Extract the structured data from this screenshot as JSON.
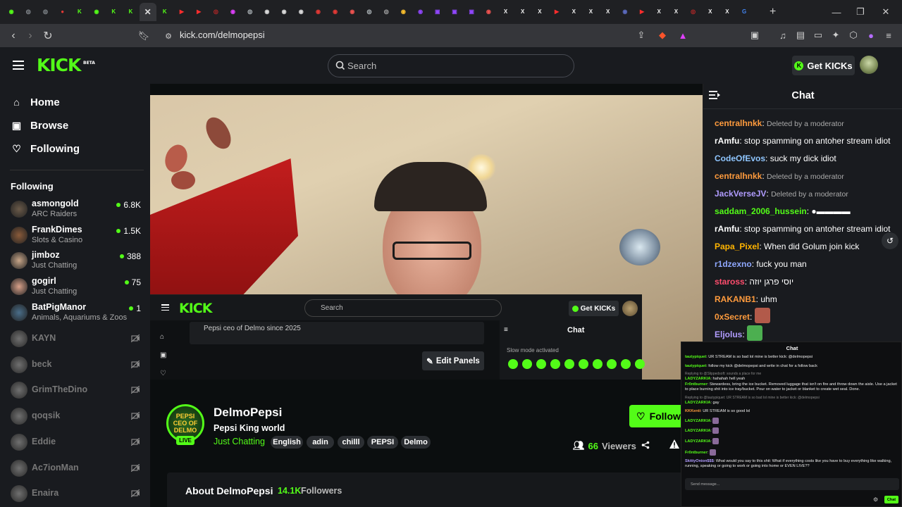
{
  "browser": {
    "tabs": [
      {
        "c": "#53fc18",
        "g": "◉"
      },
      {
        "c": "#9aa0a6",
        "g": "◎"
      },
      {
        "c": "#9aa0a6",
        "g": "◎"
      },
      {
        "c": "#e53935",
        "g": "●"
      },
      {
        "c": "#53fc18",
        "g": "K"
      },
      {
        "c": "#53fc18",
        "g": "◉"
      },
      {
        "c": "#53fc18",
        "g": "K"
      },
      {
        "c": "#53fc18",
        "g": "K"
      },
      {
        "c": "#ddd",
        "g": "✕",
        "active": true
      },
      {
        "c": "#53fc18",
        "g": "K"
      },
      {
        "c": "#ff2d2d",
        "g": "▶"
      },
      {
        "c": "#ff2d2d",
        "g": "▶"
      },
      {
        "c": "#c62828",
        "g": "◎"
      },
      {
        "c": "#e040fb",
        "g": "◉"
      },
      {
        "c": "#cfd8dc",
        "g": "◎"
      },
      {
        "c": "#ddd",
        "g": "◉"
      },
      {
        "c": "#ddd",
        "g": "◉"
      },
      {
        "c": "#ddd",
        "g": "◉"
      },
      {
        "c": "#e53935",
        "g": "◉"
      },
      {
        "c": "#e53935",
        "g": "◉"
      },
      {
        "c": "#ef5350",
        "g": "◉"
      },
      {
        "c": "#cfd8dc",
        "g": "◎"
      },
      {
        "c": "#bbb",
        "g": "◎"
      },
      {
        "c": "#fbc02d",
        "g": "◉"
      },
      {
        "c": "#9146ff",
        "g": "◉"
      },
      {
        "c": "#9146ff",
        "g": "▣"
      },
      {
        "c": "#9146ff",
        "g": "▣"
      },
      {
        "c": "#9146ff",
        "g": "▣"
      },
      {
        "c": "#ef5350",
        "g": "◉"
      },
      {
        "c": "#eee",
        "g": "X"
      },
      {
        "c": "#eee",
        "g": "X"
      },
      {
        "c": "#eee",
        "g": "X"
      },
      {
        "c": "#ff2d2d",
        "g": "▶"
      },
      {
        "c": "#eee",
        "g": "X"
      },
      {
        "c": "#eee",
        "g": "X"
      },
      {
        "c": "#eee",
        "g": "X"
      },
      {
        "c": "#5c6bc0",
        "g": "◉"
      },
      {
        "c": "#ff2d2d",
        "g": "▶"
      },
      {
        "c": "#eee",
        "g": "X"
      },
      {
        "c": "#eee",
        "g": "X"
      },
      {
        "c": "#c62828",
        "g": "◎"
      },
      {
        "c": "#eee",
        "g": "X"
      },
      {
        "c": "#eee",
        "g": "X"
      },
      {
        "c": "#4285f4",
        "g": "G"
      }
    ],
    "url": "kick.com/delmopepsi"
  },
  "header": {
    "logo": "KICK",
    "logo_sup": "BETA",
    "search_placeholder": "Search",
    "get_kicks": "Get KICKs"
  },
  "sidebar": {
    "nav": [
      {
        "label": "Home",
        "icon": "home-icon"
      },
      {
        "label": "Browse",
        "icon": "browse-icon"
      },
      {
        "label": "Following",
        "icon": "heart-icon"
      }
    ],
    "following_heading": "Following",
    "live": [
      {
        "name": "asmongold",
        "cat": "ARC Raiders",
        "viewers": "6.8K",
        "color": "#6b5b4a"
      },
      {
        "name": "FrankDimes",
        "cat": "Slots & Casino",
        "viewers": "1.5K",
        "color": "#8a5b3a"
      },
      {
        "name": "jimboz",
        "cat": "Just Chatting",
        "viewers": "388",
        "color": "#c9a78a"
      },
      {
        "name": "gogirl",
        "cat": "Just Chatting",
        "viewers": "75",
        "color": "#d9a18a"
      },
      {
        "name": "BatPigManor",
        "cat": "Animals, Aquariums & Zoos",
        "viewers": "1",
        "color": "#4a6e8a"
      }
    ],
    "offline": [
      "KAYN",
      "beck",
      "GrimTheDino",
      "qoqsik",
      "Eddie",
      "Ac7ionMan",
      "Enaira"
    ]
  },
  "video_overlay": {
    "search": "Search",
    "get_kicks": "Get KICKs",
    "bio": "Pepsi ceo of Delmo since 2025",
    "edit_panels": "Edit Panels",
    "chat_title": "Chat",
    "slow_mode": "Slow mode activated"
  },
  "channel": {
    "name": "DelmoPepsi",
    "title": "Pepsi King world",
    "category": "Just Chatting",
    "tags": [
      "English",
      "adin",
      "chilll",
      "PEPSI",
      "Delmo"
    ],
    "live": "LIVE",
    "follow": "Follow",
    "viewers_count": "66",
    "viewers_label": "Viewers",
    "avatar_text": "PEPSI CEO OF DELMO",
    "about_title": "About DelmoPepsi",
    "followers_count": "14.1K",
    "followers_label": "Followers"
  },
  "chat": {
    "title": "Chat",
    "messages": [
      {
        "user": "centralhnkk",
        "color": "#ff9b3d",
        "text": "Deleted by a moderator",
        "deleted": true
      },
      {
        "user": "rAmfu",
        "color": "#ffffff",
        "text": "stop spamming on antoher stream idiot"
      },
      {
        "user": "CodeOfEvos",
        "color": "#8fc6ff",
        "text": "suck my dick idiot"
      },
      {
        "user": "centralhnkk",
        "color": "#ff9b3d",
        "text": "Deleted by a moderator",
        "deleted": true
      },
      {
        "user": "JackVerseJV",
        "color": "#b19cff",
        "text": "Deleted by a moderator",
        "deleted": true
      },
      {
        "user": "saddam_2006_hussein",
        "color": "#53fc18",
        "text": "●▬▬▬▬"
      },
      {
        "user": "rAmfu",
        "color": "#ffffff",
        "text": "stop spamming on antoher stream idiot"
      },
      {
        "user": "Papa_Pixel",
        "color": "#ffb400",
        "text": "When did Golum join kick"
      },
      {
        "user": "r1dzexno",
        "color": "#8fa8ff",
        "text": "fuck you man"
      },
      {
        "user": "staross",
        "color": "#ff4d6d",
        "text": "יוסי פרגן יוזה"
      },
      {
        "user": "RAKANB1",
        "color": "#ff9b3d",
        "text": "uhm"
      },
      {
        "user": "0xSecret",
        "color": "#ff9b3d",
        "text": "",
        "emote": "#b25a4a"
      },
      {
        "user": "Eljolus",
        "color": "#b19cff",
        "text": "",
        "emote": "#4caf50"
      }
    ]
  },
  "popout_chat": {
    "title": "Chat",
    "messages": [
      {
        "user": "tautypiquet",
        "color": "#53fc18",
        "text": "UR STREAM is so bad lol mine is better kick: @delmopepsi"
      },
      {
        "user": "tautypiquet",
        "color": "#53fc18",
        "text": "follow my kick @delmopepsi and write in chat for a follow back"
      },
      {
        "reply": "Replying to @Slippedsoft: sounds a place for me",
        "user": "LADYZARKIA",
        "color": "#53fc18",
        "text": "hahahah hell yeah"
      },
      {
        "user": "Fr0ntburner",
        "color": "#53fc18",
        "text": "Stewardess, bring the ice bucket. Removed luggage that isn't on fire and throw down the aisle. Use a jacket to place burning shit into ice tray/bucket. Pour on water to jacket or blanket to create wet seal. Done."
      },
      {
        "reply": "Replying to @tautypiquet: UR STREAM is so bad lol mine is better kick: @delmopepsi",
        "user": "LADYZARKIA",
        "color": "#53fc18",
        "text": "gay"
      },
      {
        "user": "KKKenti",
        "color": "#ff9b3d",
        "text": "UR STREAM is so good lol"
      },
      {
        "user": "LADYZARKIA",
        "color": "#53fc18",
        "text": ""
      },
      {
        "user": "LADYZARKIA",
        "color": "#53fc18",
        "text": ""
      },
      {
        "user": "LADYZARKIA",
        "color": "#53fc18",
        "text": ""
      },
      {
        "user": "Fr0ntburner",
        "color": "#53fc18",
        "text": ""
      },
      {
        "user": "SkittyOnion$$$",
        "color": "#b19cff",
        "text": "What would you say to this shit: What if everything costs like you have to buy everything like walking, running, speaking or going to work or going into home or EVEN LIVE??"
      }
    ],
    "input_placeholder": "Send message...",
    "send": "Chat"
  }
}
